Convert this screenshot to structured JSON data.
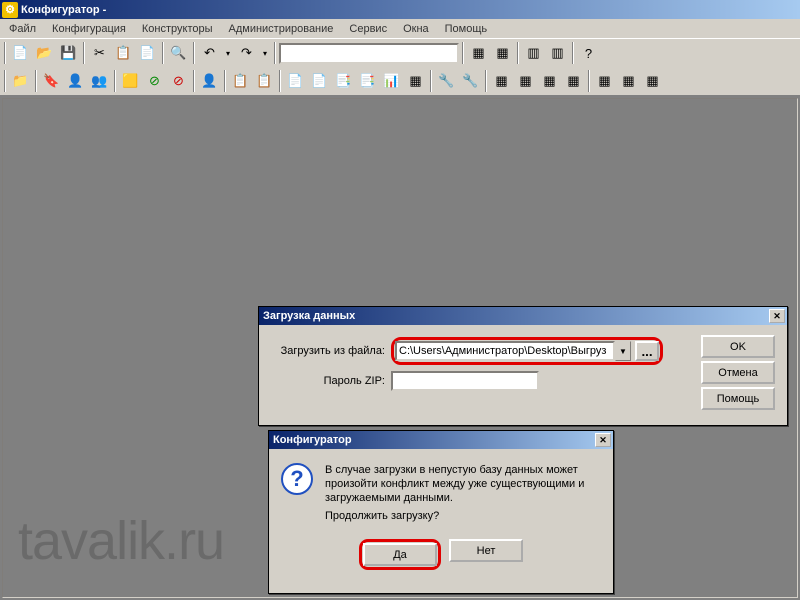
{
  "title": "Конфигуратор -",
  "menu": [
    "Файл",
    "Конфигурация",
    "Конструкторы",
    "Администрирование",
    "Сервис",
    "Окна",
    "Помощь"
  ],
  "dlg_load": {
    "title": "Загрузка данных",
    "load_label": "Загрузить из файла:",
    "file_value": "C:\\Users\\Администратор\\Desktop\\Выгруз",
    "browse": "...",
    "pwd_label": "Пароль ZIP:",
    "pwd_value": "",
    "ok": "OK",
    "cancel": "Отмена",
    "help": "Помощь"
  },
  "dlg_confirm": {
    "title": "Конфигуратор",
    "message1": "В случае загрузки в непустую базу данных может произойти конфликт между уже существующими и загружаемыми данными.",
    "message2": "Продолжить загрузку?",
    "yes": "Да",
    "no": "Нет"
  },
  "watermark": "tavalik.ru"
}
